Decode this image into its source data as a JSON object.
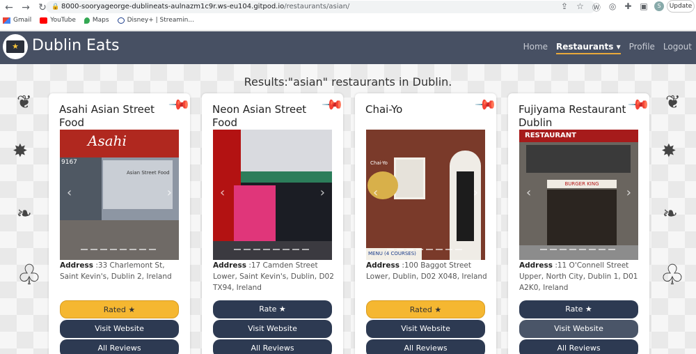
{
  "browser": {
    "url_host": "8000-sooryageorge-dublineats-aulnazm1c9r.ws-eu104.gitpod.io",
    "url_path": "/restaurants/asian/",
    "update_label": "Update",
    "avatar_letter": "S",
    "bookmarks": [
      {
        "label": "Gmail",
        "icon": "gmail-icon"
      },
      {
        "label": "YouTube",
        "icon": "youtube-icon"
      },
      {
        "label": "Maps",
        "icon": "maps-icon"
      },
      {
        "label": "Disney+ | Streamin...",
        "icon": "disney-icon"
      }
    ]
  },
  "navbar": {
    "brand": "Dublin Eats",
    "links": {
      "home": "Home",
      "restaurants": "Restaurants",
      "profile": "Profile",
      "logout": "Logout"
    }
  },
  "results_heading": "Results:\"asian\" restaurants in Dublin.",
  "cards": [
    {
      "title": "Asahi Asian Street Food",
      "address_label": "Address",
      "address": ":33 Charlemont St, Saint Kevin's, Dublin 2, Ireland",
      "rate_label": "Rated ★",
      "visit_label": "Visit Website",
      "reviews_label": "All Reviews",
      "rated": true
    },
    {
      "title": "Neon Asian Street Food",
      "address_label": "Address",
      "address": ":17 Camden Street Lower, Saint Kevin's, Dublin, D02 TX94, Ireland",
      "rate_label": "Rate ★",
      "visit_label": "Visit Website",
      "reviews_label": "All Reviews",
      "rated": false
    },
    {
      "title": "Chai-Yo",
      "address_label": "Address",
      "address": ":100 Baggot Street Lower, Dublin, D02 X048, Ireland",
      "rate_label": "Rated ★",
      "visit_label": "Visit Website",
      "reviews_label": "All Reviews",
      "rated": true
    },
    {
      "title": "Fujiyama Restaurant Dublin",
      "address_label": "Address",
      "address": ":11 O'Connell Street Upper, North City, Dublin 1, D01 A2K0, Ireland",
      "rate_label": "Rate ★",
      "visit_label": "Visit Website",
      "reviews_label": "All Reviews",
      "rated": false
    }
  ],
  "photo_signs": {
    "asahi": "Asahi",
    "asahi_number": "9167",
    "asahi_sub": "Asian Street Food",
    "chaiyo": "Chai-Yo",
    "chaiyo_menu": "MENU (4 COURSES)",
    "fujiyama": "RESTAURANT",
    "fujiyama_bk": "BURGER KING"
  },
  "colors": {
    "navbar": "#475063",
    "button_dark": "#2d3a52",
    "button_rated": "#f5b731",
    "active_underline": "#e9a93a"
  }
}
